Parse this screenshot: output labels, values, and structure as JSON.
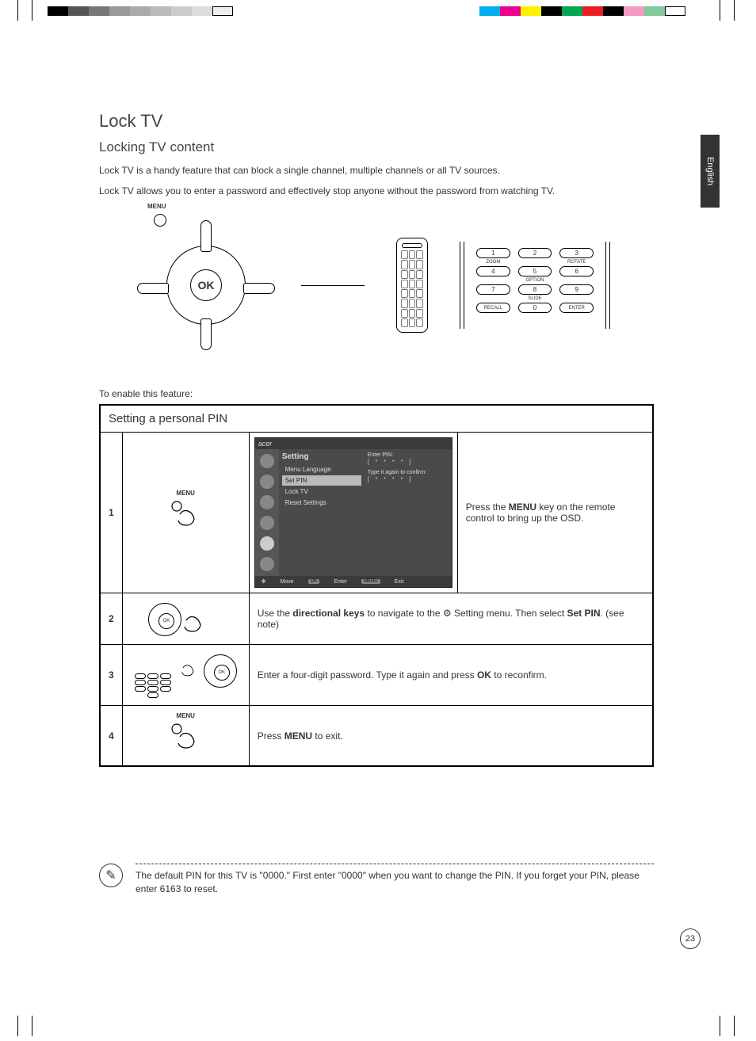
{
  "language_tab": "English",
  "page_number": "23",
  "title": "Lock TV",
  "subtitle": "Locking TV content",
  "intro_p1": "Lock TV is a handy feature that can block a single channel, multiple channels or all TV sources.",
  "intro_p2": "Lock TV allows you to enter a password and effectively stop anyone without the password from watching TV.",
  "dpad": {
    "ok": "OK",
    "menu_label": "MENU"
  },
  "keypad": {
    "keys": [
      "1",
      "2",
      "3",
      "4",
      "5",
      "6",
      "7",
      "8",
      "9",
      "0"
    ],
    "labels": {
      "zoom": "ZOOM",
      "rotate": "ROTATE",
      "option": "OPTION",
      "slide": "SLIDE",
      "recall": "RECALL",
      "enter": "ENTER"
    }
  },
  "enable_label": "To enable this feature:",
  "table_header": "Setting a personal PIN",
  "osd": {
    "brand": "acer",
    "section": "Setting",
    "items": [
      "Menu Language",
      "Set PIN",
      "Lock TV",
      "Reset Settings"
    ],
    "right_label1": "Enter PIN:",
    "right_stars1": "[ *  *  *  * ]",
    "right_label2": "Type it again to confirm:",
    "right_stars2": "[ *  *  *  * ]",
    "footer": {
      "move": "Move",
      "enter": "Enter",
      "exit": "Exit",
      "ok_tag": "OK",
      "menu_tag": "MENU"
    }
  },
  "steps": {
    "s1": {
      "num": "1",
      "img_label": "MENU",
      "desc_pre": "Press the ",
      "desc_b1": "MENU",
      "desc_post": " key on the remote control to bring up the OSD."
    },
    "s2": {
      "num": "2",
      "desc_pre": "Use the ",
      "desc_b1": "directional keys",
      "desc_mid": " to navigate to the ",
      "desc_mid2": " Setting menu. Then select ",
      "desc_b2": "Set PIN",
      "desc_post": ". (see note)"
    },
    "s3": {
      "num": "3",
      "desc_pre": "Enter a four-digit password. Type it again and press ",
      "desc_b1": "OK",
      "desc_post": " to reconfirm."
    },
    "s4": {
      "num": "4",
      "img_label": "MENU",
      "desc_pre": "Press ",
      "desc_b1": "MENU",
      "desc_post": " to exit."
    }
  },
  "note": "The default PIN for this TV is \"0000.\" First enter \"0000\" when you want to change the PIN. If you forget your PIN, please enter 6163 to reset.",
  "color_bar_left": [
    "#000",
    "#555",
    "#777",
    "#999",
    "#aaa",
    "#bbb",
    "#ccc",
    "#ddd",
    "#eee",
    "#fff"
  ],
  "color_bar_right": [
    "#00aeef",
    "#ec008c",
    "#fff200",
    "#000",
    "#00a651",
    "#ed1c24",
    "#000",
    "#f49ac1",
    "#82ca9c",
    "#fff"
  ]
}
